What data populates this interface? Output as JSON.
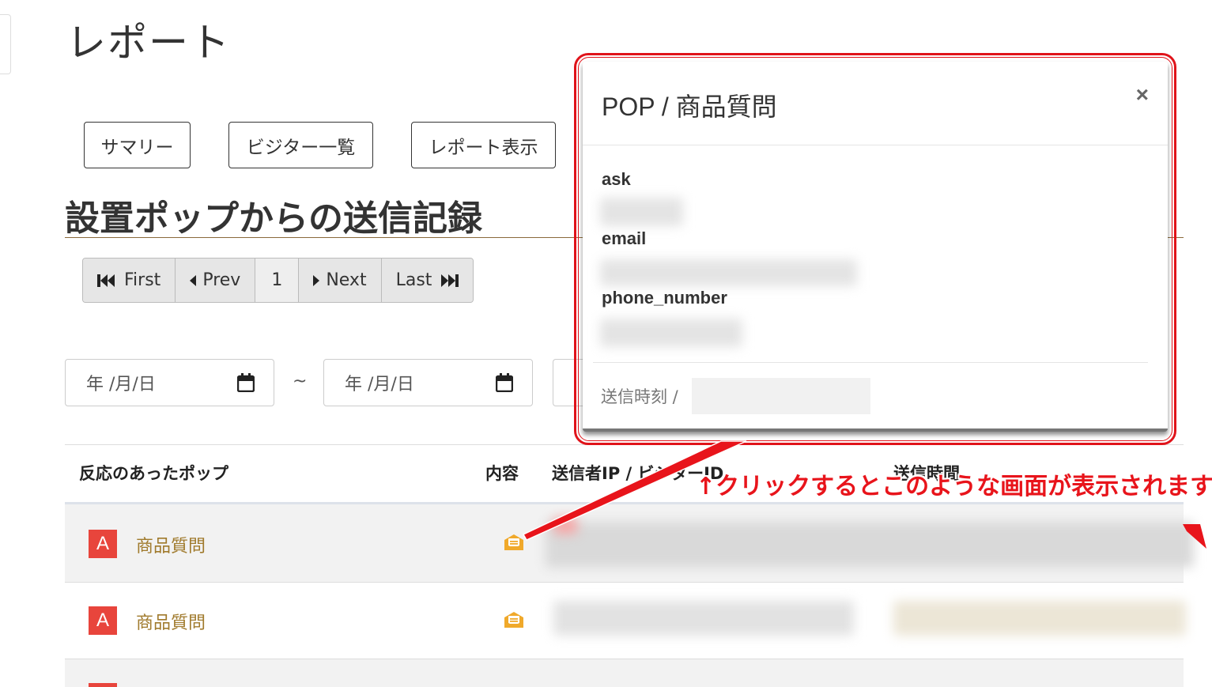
{
  "page": {
    "title": "レポート"
  },
  "tabs": [
    {
      "label": "サマリー"
    },
    {
      "label": "ビジター一覧"
    },
    {
      "label": "レポート表示"
    }
  ],
  "section": {
    "title": "設置ポップからの送信記録"
  },
  "pagination": {
    "first": "First",
    "prev": "Prev",
    "page": "1",
    "next": "Next",
    "last": "Last"
  },
  "filter": {
    "date_from": "年 /月/日",
    "date_to": "年 /月/日",
    "separator": "~"
  },
  "table": {
    "headers": [
      "反応のあったポップ",
      "内容",
      "送信者IP / ビジターID",
      "送信時間"
    ],
    "rows": [
      {
        "badge": "A",
        "pop_name": "商品質問"
      },
      {
        "badge": "A",
        "pop_name": "商品質問"
      }
    ]
  },
  "modal": {
    "title": "POP / 商品質問",
    "close": "×",
    "fields": [
      "ask",
      "email",
      "phone_number"
    ],
    "sent_time_label": "送信時刻 /"
  },
  "annotation": {
    "text": "↑クリックするとこのような画面が表示されます",
    "color": "#e8141b"
  },
  "colors": {
    "accent_gold": "#a07a2c",
    "badge_red": "#e8453c",
    "mail_icon": "#f0a92b"
  }
}
